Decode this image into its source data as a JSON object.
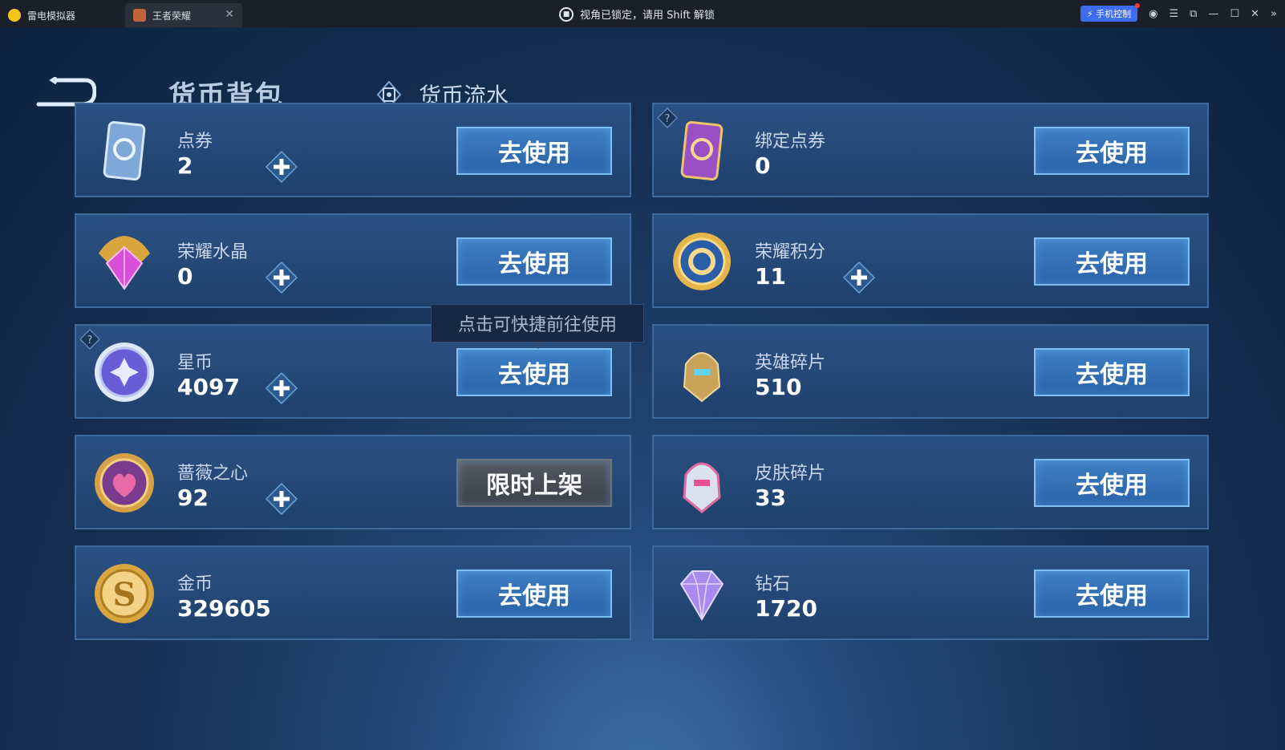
{
  "window": {
    "app_tab_label": "雷电模拟器",
    "game_tab_label": "王者荣耀",
    "lock_message": "视角已锁定，请用 Shift 解锁",
    "phone_control_label": "手机控制"
  },
  "header": {
    "title": "货币背包",
    "flow_tab_label": "货币流水"
  },
  "tooltip": "点击可快捷前往使用",
  "currencies": [
    {
      "name": "点券",
      "value": "2",
      "button": "去使用",
      "icon": "ticket-blue-icon"
    },
    {
      "name": "绑定点券",
      "value": "0",
      "button": "去使用",
      "icon": "ticket-purple-icon"
    },
    {
      "name": "荣耀水晶",
      "value": "0",
      "button": "去使用",
      "icon": "crystal-icon"
    },
    {
      "name": "荣耀积分",
      "value": "11",
      "button": "去使用",
      "icon": "points-coin-icon"
    },
    {
      "name": "星币",
      "value": "4097",
      "button": "去使用",
      "icon": "star-coin-icon"
    },
    {
      "name": "英雄碎片",
      "value": "510",
      "button": "去使用",
      "icon": "hero-shard-icon"
    },
    {
      "name": "蔷薇之心",
      "value": "92",
      "button": "限时上架",
      "icon": "rose-heart-icon"
    },
    {
      "name": "皮肤碎片",
      "value": "33",
      "button": "去使用",
      "icon": "skin-shard-icon"
    },
    {
      "name": "金币",
      "value": "329605",
      "button": "去使用",
      "icon": "gold-coin-icon"
    },
    {
      "name": "钻石",
      "value": "1720",
      "button": "去使用",
      "icon": "diamond-icon"
    }
  ]
}
